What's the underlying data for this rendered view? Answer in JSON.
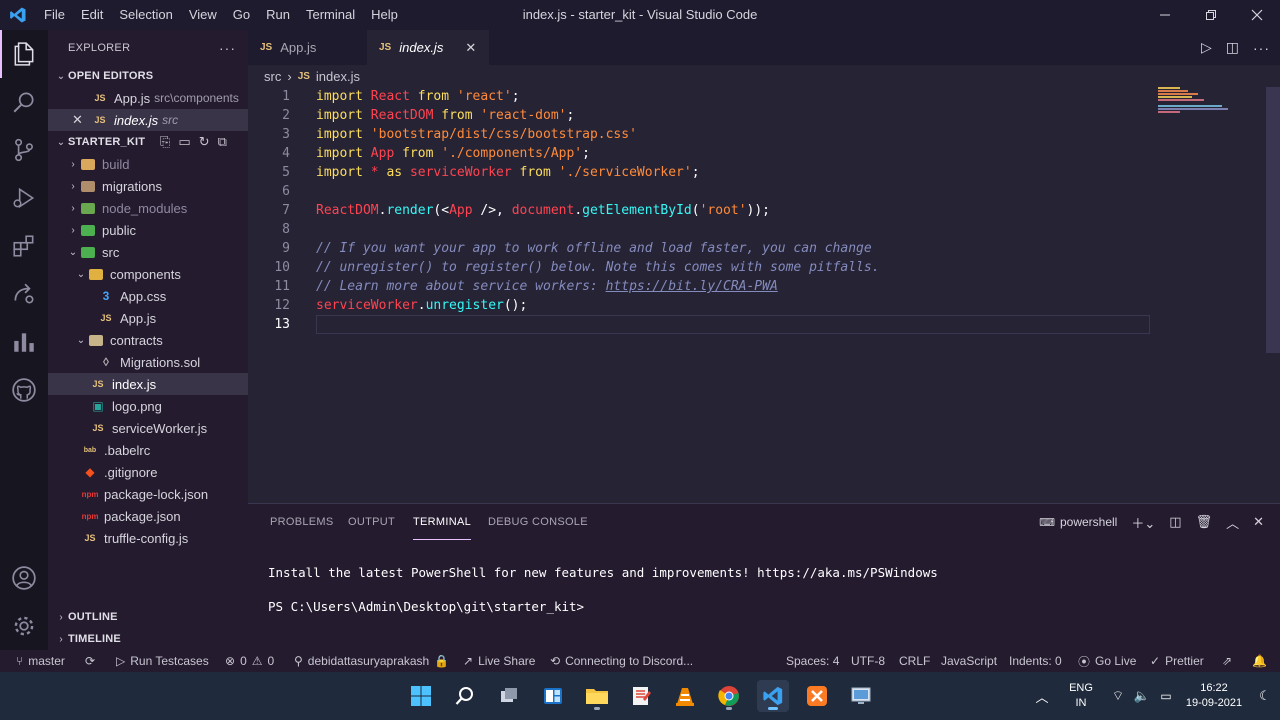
{
  "window": {
    "title": "index.js - starter_kit - Visual Studio Code",
    "menu": [
      "File",
      "Edit",
      "Selection",
      "View",
      "Go",
      "Run",
      "Terminal",
      "Help"
    ]
  },
  "sidebar": {
    "header": "EXPLORER",
    "open_editors_label": "OPEN EDITORS",
    "open_editors": [
      {
        "name": "App.js",
        "desc": "src\\components"
      },
      {
        "name": "index.js",
        "desc": "src"
      }
    ],
    "project_label": "STARTER_KIT",
    "tree": [
      {
        "name": "build"
      },
      {
        "name": "migrations"
      },
      {
        "name": "node_modules"
      },
      {
        "name": "public"
      },
      {
        "name": "src"
      },
      {
        "name": "components"
      },
      {
        "name": "App.css"
      },
      {
        "name": "App.js"
      },
      {
        "name": "contracts"
      },
      {
        "name": "Migrations.sol"
      },
      {
        "name": "index.js"
      },
      {
        "name": "logo.png"
      },
      {
        "name": "serviceWorker.js"
      },
      {
        "name": ".babelrc"
      },
      {
        "name": ".gitignore"
      },
      {
        "name": "package-lock.json"
      },
      {
        "name": "package.json"
      },
      {
        "name": "truffle-config.js"
      }
    ],
    "outline_label": "OUTLINE",
    "timeline_label": "TIMELINE"
  },
  "tabs": [
    {
      "label": "App.js",
      "icon": "JS"
    },
    {
      "label": "index.js",
      "icon": "JS"
    }
  ],
  "breadcrumb": {
    "folder": "src",
    "file": "index.js"
  },
  "editor": {
    "line_numbers": [
      "1",
      "2",
      "3",
      "4",
      "5",
      "6",
      "7",
      "8",
      "9",
      "10",
      "11",
      "12",
      "13"
    ],
    "lines": [
      [
        [
          "kw",
          "import"
        ],
        [
          "pl",
          " "
        ],
        [
          "id",
          "React"
        ],
        [
          "pl",
          " "
        ],
        [
          "kw",
          "from"
        ],
        [
          "pl",
          " "
        ],
        [
          "str",
          "'react'"
        ],
        [
          "pl",
          ";"
        ]
      ],
      [
        [
          "kw",
          "import"
        ],
        [
          "pl",
          " "
        ],
        [
          "id",
          "ReactDOM"
        ],
        [
          "pl",
          " "
        ],
        [
          "kw",
          "from"
        ],
        [
          "pl",
          " "
        ],
        [
          "str",
          "'react-dom'"
        ],
        [
          "pl",
          ";"
        ]
      ],
      [
        [
          "kw",
          "import"
        ],
        [
          "pl",
          " "
        ],
        [
          "str",
          "'bootstrap/dist/css/bootstrap.css'"
        ]
      ],
      [
        [
          "kw",
          "import"
        ],
        [
          "pl",
          " "
        ],
        [
          "id",
          "App"
        ],
        [
          "pl",
          " "
        ],
        [
          "kw",
          "from"
        ],
        [
          "pl",
          " "
        ],
        [
          "str",
          "'./components/App'"
        ],
        [
          "pl",
          ";"
        ]
      ],
      [
        [
          "kw",
          "import"
        ],
        [
          "pl",
          " "
        ],
        [
          "id",
          "*"
        ],
        [
          "pl",
          " "
        ],
        [
          "kw",
          "as"
        ],
        [
          "pl",
          " "
        ],
        [
          "id",
          "serviceWorker"
        ],
        [
          "pl",
          " "
        ],
        [
          "kw",
          "from"
        ],
        [
          "pl",
          " "
        ],
        [
          "str",
          "'./serviceWorker'"
        ],
        [
          "pl",
          ";"
        ]
      ],
      [],
      [
        [
          "id",
          "ReactDOM"
        ],
        [
          "pl",
          "."
        ],
        [
          "fn",
          "render"
        ],
        [
          "pl",
          "(<"
        ],
        [
          "id",
          "App"
        ],
        [
          "pl",
          " />, "
        ],
        [
          "id",
          "document"
        ],
        [
          "pl",
          "."
        ],
        [
          "fn",
          "getElementById"
        ],
        [
          "pl",
          "("
        ],
        [
          "str",
          "'root'"
        ],
        [
          "pl",
          "));"
        ]
      ],
      [],
      [
        [
          "cmt",
          "// If you want your app to work offline and load faster, you can change"
        ]
      ],
      [
        [
          "cmt",
          "// unregister() to register() below. Note this comes with some pitfalls."
        ]
      ],
      [
        [
          "cmt",
          "// Learn more about service workers: "
        ],
        [
          "cmt link",
          "https://bit.ly/CRA-PWA"
        ]
      ],
      [
        [
          "id",
          "serviceWorker"
        ],
        [
          "pl",
          "."
        ],
        [
          "fn",
          "unregister"
        ],
        [
          "pl",
          "();"
        ]
      ],
      []
    ]
  },
  "panel": {
    "tabs": [
      "PROBLEMS",
      "OUTPUT",
      "TERMINAL",
      "DEBUG CONSOLE"
    ],
    "shell": "powershell",
    "terminal_lines": [
      "Install the latest PowerShell for new features and improvements! https://aka.ms/PSWindows",
      "PS C:\\Users\\Admin\\Desktop\\git\\starter_kit>"
    ]
  },
  "statusbar": {
    "branch": "master",
    "run_testcases": "Run Testcases",
    "errors": "0",
    "warnings": "0",
    "user": "debidattasuryaprakash",
    "live_share": "Live Share",
    "discord": "Connecting to Discord...",
    "spaces": "Spaces: 4",
    "encoding": "UTF-8",
    "eol": "CRLF",
    "language": "JavaScript",
    "indents": "Indents: 0",
    "go_live": "Go Live",
    "prettier": "Prettier"
  },
  "taskbar": {
    "lang1": "ENG",
    "lang2": "IN",
    "time": "16:22",
    "date": "19-09-2021"
  },
  "colors": {
    "accent": "#e7c0ff",
    "keyword": "#fede5d",
    "string": "#ff8b39",
    "identifier": "#fe4450",
    "function": "#36f9f6",
    "comment": "#848bbd"
  }
}
